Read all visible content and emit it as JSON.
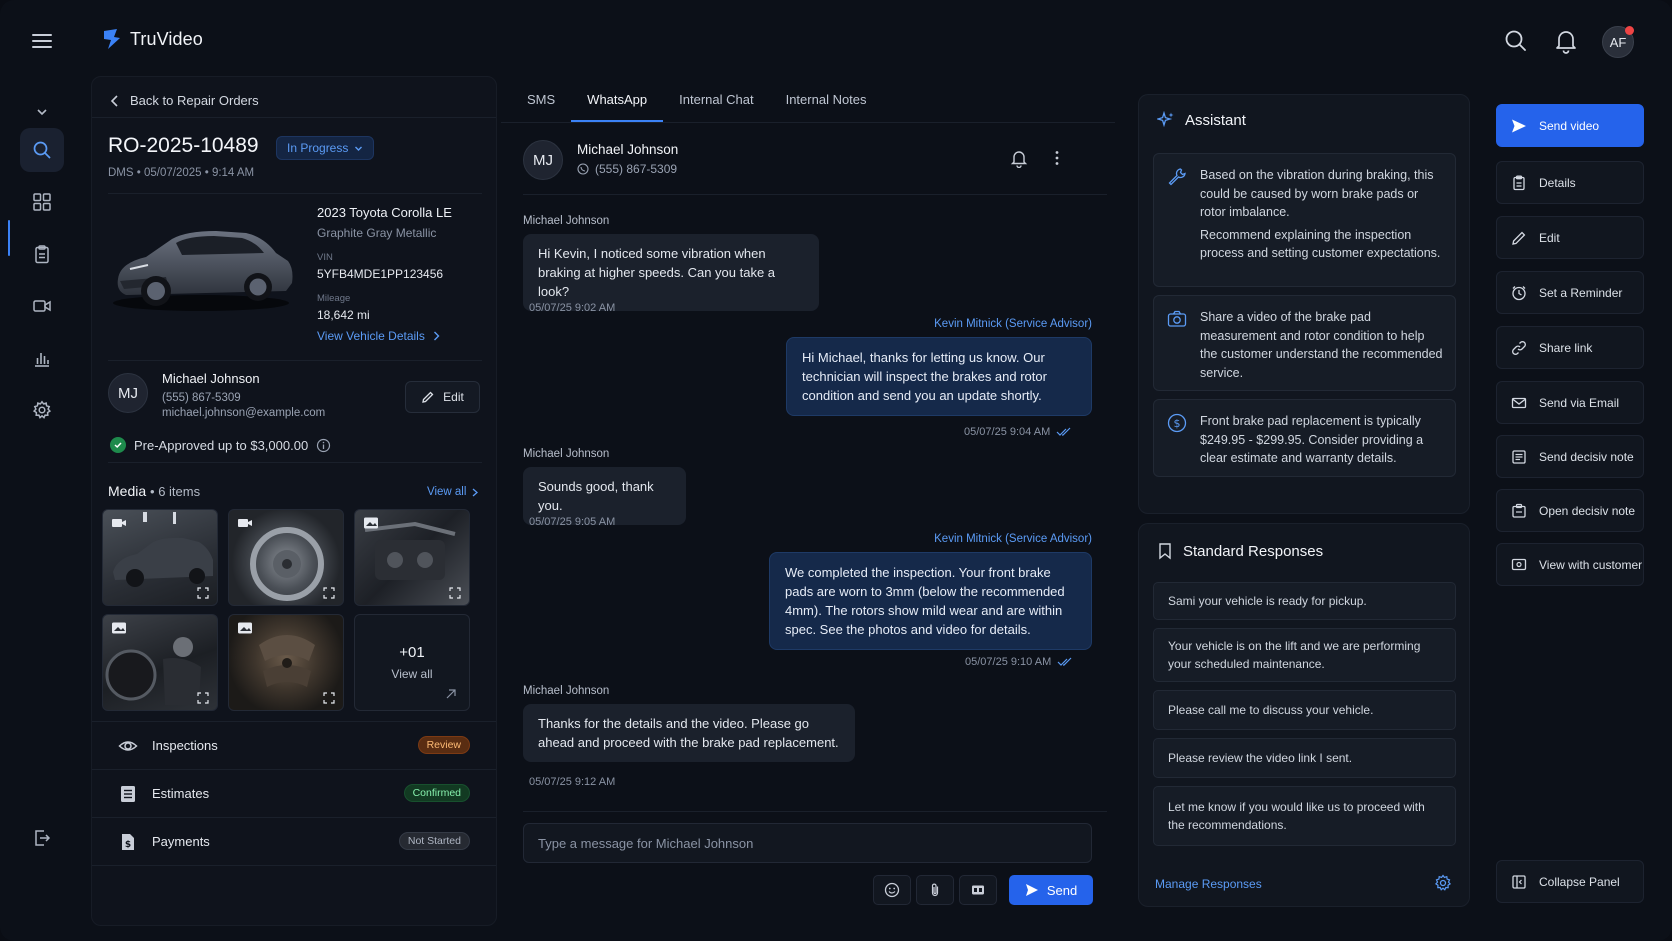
{
  "app": {
    "name": "TruVideo",
    "user_initials": "AF"
  },
  "left": {
    "back_label": "Back to Repair Orders",
    "ro_number": "RO-2025-10489",
    "status": "In Progress",
    "meta": "DMS • 05/07/2025 • 9:14 AM",
    "vehicle": {
      "name": "2023 Toyota Corolla LE",
      "color": "Graphite Gray Metallic",
      "vin_label": "VIN",
      "vin": "5YFB4MDE1PP123456",
      "mileage_label": "Mileage",
      "mileage": "18,642 mi",
      "details_link": "View Vehicle Details"
    },
    "customer": {
      "initials": "MJ",
      "name": "Michael Johnson",
      "phone": "(555) 867-5309",
      "email": "michael.johnson@example.com",
      "edit_label": "Edit"
    },
    "preapproval": "Pre-Approved up to $3,000.00",
    "media": {
      "title": "Media",
      "count": "6 items",
      "view_all": "View all",
      "more_count": "+01",
      "more_label": "View all"
    },
    "rows": [
      {
        "label": "Inspections",
        "badge": "Review",
        "badge_color": "#f97316"
      },
      {
        "label": "Estimates",
        "badge": "Confirmed",
        "badge_color": "#22c55e"
      },
      {
        "label": "Payments",
        "badge": "Not Started",
        "badge_color": "#6b7280"
      }
    ]
  },
  "chat": {
    "tabs": [
      "SMS",
      "WhatsApp",
      "Internal Chat",
      "Internal Notes"
    ],
    "active_tab": "WhatsApp",
    "contact": {
      "initials": "MJ",
      "name": "Michael Johnson",
      "phone": "(555) 867-5309"
    },
    "messages": [
      {
        "dir": "in",
        "sender": "Michael Johnson",
        "text": "Hi Kevin, I noticed some vibration when braking at higher speeds. Can you take a look?",
        "time": "05/07/25 9:02 AM"
      },
      {
        "dir": "out",
        "sender": "Kevin Mitnick (Service Advisor)",
        "text": "Hi Michael, thanks for letting us know. Our technician will inspect the brakes and rotor condition and send you an update shortly.",
        "time": "05/07/25 9:04 AM"
      },
      {
        "dir": "in",
        "sender": "Michael Johnson",
        "text": "Sounds good, thank you.",
        "time": "05/07/25 9:05 AM"
      },
      {
        "dir": "out",
        "sender": "Kevin Mitnick (Service Advisor)",
        "text": "We completed the inspection. Your front brake pads are worn to 3mm (below the recommended 4mm). The rotors show mild wear and are within spec. See the photos and video for details.",
        "time": "05/07/25 9:10 AM"
      },
      {
        "dir": "in",
        "sender": "Michael Johnson",
        "text": "Thanks for the details and the video. Please go ahead and proceed with the brake pad replacement.",
        "time": "05/07/25 9:12 AM"
      }
    ],
    "composer_placeholder": "Type a message for Michael Johnson",
    "send_label": "Send"
  },
  "assistant": {
    "title": "Assistant",
    "cards": [
      {
        "icon": "wrench-icon",
        "text": "Based on the vibration during braking, this could be caused by worn brake pads or rotor imbalance.",
        "text2": "Recommend explaining the inspection process and setting customer expectations."
      },
      {
        "icon": "camera-icon",
        "text": "Share a video of the brake pad measurement and rotor condition to help the customer understand the recommended service."
      },
      {
        "icon": "dollar-icon",
        "text": "Front brake pad replacement is typically $249.95 - $299.95. Consider providing a clear estimate and warranty details."
      }
    ]
  },
  "standard": {
    "title": "Standard Responses",
    "items": [
      "Sami your vehicle is ready for pickup.",
      "Your vehicle is on the lift and we are performing your scheduled maintenance.",
      "Please call me to discuss your vehicle.",
      "Please review the video link I sent.",
      "Let me know if you would like us to proceed with the recommendations."
    ],
    "manage_label": "Manage Responses"
  },
  "actions": [
    {
      "label": "Send video",
      "icon": "send-icon"
    },
    {
      "label": "Details",
      "icon": "clipboard-icon"
    },
    {
      "label": "Edit",
      "icon": "pencil-icon"
    },
    {
      "label": "Set a Reminder",
      "icon": "clock-icon"
    },
    {
      "label": "Share link",
      "icon": "link-icon"
    },
    {
      "label": "Send via Email",
      "icon": "mail-icon"
    },
    {
      "label": "Send decisiv note",
      "icon": "note-icon"
    },
    {
      "label": "Open decisiv note",
      "icon": "open-note-icon"
    },
    {
      "label": "View with customer",
      "icon": "screen-icon"
    },
    {
      "label": "Collapse Panel",
      "icon": "collapse-icon"
    }
  ]
}
